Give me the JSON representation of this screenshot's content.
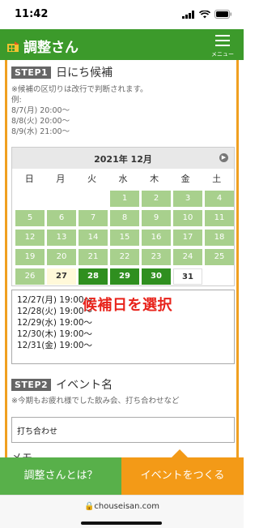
{
  "status": {
    "time": "11:42"
  },
  "header": {
    "logo_text": "調整さん",
    "menu_label": "メニュー"
  },
  "step1": {
    "badge": "STEP1",
    "title": "日にち候補",
    "note_lines": [
      "※候補の区切りは改行で判断されます。",
      "例:",
      "8/7(月) 20:00〜",
      "8/8(火) 20:00〜",
      "8/9(水) 21:00〜"
    ]
  },
  "calendar": {
    "title": "2021年 12月",
    "weekdays": [
      "日",
      "月",
      "火",
      "水",
      "木",
      "金",
      "土"
    ],
    "rows": [
      [
        {
          "d": ""
        },
        {
          "d": ""
        },
        {
          "d": ""
        },
        {
          "d": "1",
          "s": "pre"
        },
        {
          "d": "2",
          "s": "pre"
        },
        {
          "d": "3",
          "s": "pre"
        },
        {
          "d": "4",
          "s": "pre"
        }
      ],
      [
        {
          "d": "5",
          "s": "pre"
        },
        {
          "d": "6",
          "s": "pre"
        },
        {
          "d": "7",
          "s": "pre"
        },
        {
          "d": "8",
          "s": "pre"
        },
        {
          "d": "9",
          "s": "pre"
        },
        {
          "d": "10",
          "s": "pre"
        },
        {
          "d": "11",
          "s": "pre"
        }
      ],
      [
        {
          "d": "12",
          "s": "pre"
        },
        {
          "d": "13",
          "s": "pre"
        },
        {
          "d": "14",
          "s": "pre"
        },
        {
          "d": "15",
          "s": "pre"
        },
        {
          "d": "16",
          "s": "pre"
        },
        {
          "d": "17",
          "s": "pre"
        },
        {
          "d": "18",
          "s": "pre"
        }
      ],
      [
        {
          "d": "19",
          "s": "pre"
        },
        {
          "d": "20",
          "s": "pre"
        },
        {
          "d": "21",
          "s": "pre"
        },
        {
          "d": "22",
          "s": "pre"
        },
        {
          "d": "23",
          "s": "pre"
        },
        {
          "d": "24",
          "s": "pre"
        },
        {
          "d": "25",
          "s": "pre"
        }
      ],
      [
        {
          "d": "26",
          "s": "pre"
        },
        {
          "d": "27",
          "s": "today"
        },
        {
          "d": "28",
          "s": "sel"
        },
        {
          "d": "29",
          "s": "sel"
        },
        {
          "d": "30",
          "s": "sel"
        },
        {
          "d": "31",
          "s": "plain"
        },
        {
          "d": ""
        }
      ]
    ]
  },
  "dates": [
    "12/27(月) 19:00〜",
    "12/28(火) 19:00〜",
    "12/29(水) 19:00〜",
    "12/30(木) 19:00〜",
    "12/31(金) 19:00〜"
  ],
  "callout": "候補日を選択",
  "step2": {
    "badge": "STEP2",
    "title": "イベント名",
    "note": "※今期もお疲れ様でした飲み会、打ち合わせなど",
    "input_value": "打ち合わせ"
  },
  "memo_label": "メモ",
  "bottom": {
    "about_label": "調整さんとは？",
    "create_label": "イベントをつくる"
  },
  "url": "chouseisan.com",
  "colors": {
    "header_green": "#3c9a2b",
    "selected_green": "#2f8f1f",
    "light_green": "#a8d08d",
    "orange": "#f39a17",
    "callout_red": "#e8231b"
  }
}
